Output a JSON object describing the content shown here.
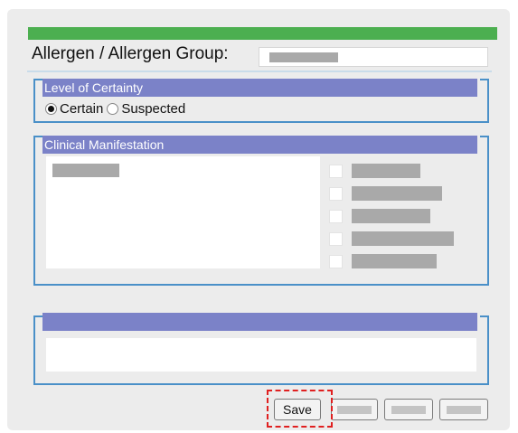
{
  "form": {
    "allergen_label": "Allergen / Allergen Group:",
    "allergen_value": ""
  },
  "certainty": {
    "header": "Level of Certainty",
    "options": [
      {
        "label": "Certain",
        "selected": true
      },
      {
        "label": "Suspected",
        "selected": false
      }
    ]
  },
  "manifestation": {
    "header": "Clinical Manifestation",
    "checkbox_count": 5
  },
  "third_group": {
    "header": ""
  },
  "buttons": {
    "save_label": "Save"
  },
  "colors": {
    "accent_bar": "#4caf50",
    "group_header": "#7b82c8",
    "group_border": "#4a90c8",
    "highlight": "#e02020"
  }
}
